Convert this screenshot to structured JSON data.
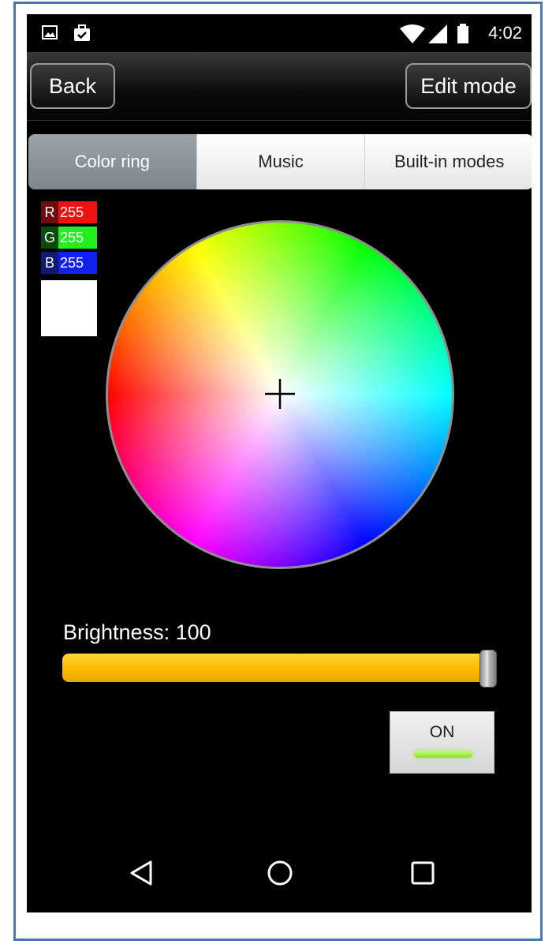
{
  "status_bar": {
    "time": "4:02",
    "icons": [
      "image-icon",
      "briefcase-check-icon",
      "wifi-icon",
      "cell-signal-icon",
      "battery-icon"
    ]
  },
  "action_bar": {
    "back_label": "Back",
    "edit_mode_label": "Edit mode"
  },
  "tabs": [
    {
      "label": "Color ring",
      "active": true
    },
    {
      "label": "Music",
      "active": false
    },
    {
      "label": "Built-in modes",
      "active": false
    }
  ],
  "rgb": {
    "r_letter": "R",
    "r_value": "255",
    "g_letter": "G",
    "g_value": "255",
    "b_letter": "B",
    "b_value": "255",
    "swatch_color": "#ffffff"
  },
  "brightness": {
    "label": "Brightness: 100",
    "value": 100,
    "max": 100
  },
  "power": {
    "label": "ON",
    "state": "on",
    "indicator_color": "#9eea4a"
  },
  "nav_bar": {
    "icons": [
      "back-triangle-icon",
      "home-circle-icon",
      "recents-square-icon"
    ]
  },
  "colors": {
    "slider": "#ffbd00",
    "tab_active": "#808b93",
    "frame_border": "#4a76b8"
  }
}
